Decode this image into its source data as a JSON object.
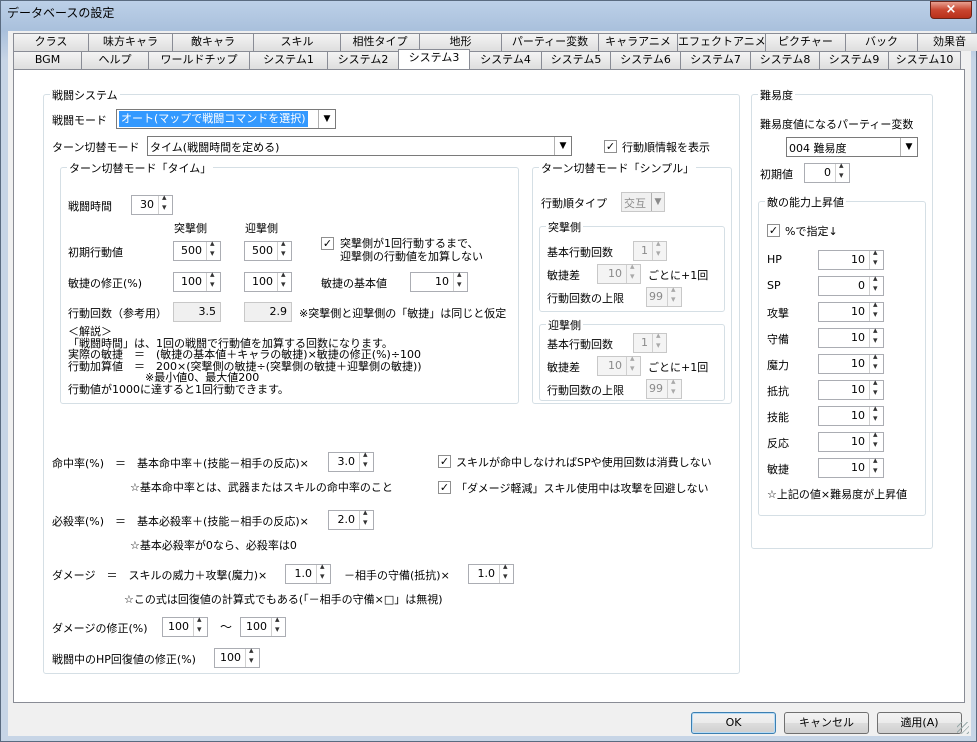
{
  "window": {
    "title": "データベースの設定",
    "close_icon": "×"
  },
  "tabs_row1": [
    "クラス",
    "味方キャラ",
    "敵キャラ",
    "スキル",
    "相性タイプ",
    "地形",
    "パーティー変数",
    "キャラアニメ",
    "エフェクトアニメ",
    "ピクチャー",
    "バック",
    "効果音"
  ],
  "tabs_row2": [
    "BGM",
    "ヘルプ",
    "ワールドチップ",
    "システム1",
    "システム2",
    "システム3",
    "システム4",
    "システム5",
    "システム6",
    "システム7",
    "システム8",
    "システム9",
    "システム10"
  ],
  "battle": {
    "group_label": "戦闘システム",
    "mode_label": "戦闘モード",
    "mode_value": "オート(マップで戦闘コマンドを選択)",
    "turn_mode_label": "ターン切替モード",
    "turn_mode_value": "タイム(戦闘時間を定める)",
    "show_order_label": "行動順情報を表示",
    "show_order_checked": "✓"
  },
  "time": {
    "group_label": "ターン切替モード「タイム」",
    "battle_time_label": "戦闘時間",
    "battle_time_value": "30",
    "attack_header": "突撃側",
    "defend_header": "迎撃側",
    "init_label": "初期行動値",
    "init_attack": "500",
    "init_defend": "500",
    "no_add_label_1": "突撃側が1回行動するまで、",
    "no_add_label_2": "迎撃側の行動値を加算しない",
    "no_add_checked": "✓",
    "agi_mod_label": "敏捷の修正(%)",
    "agi_mod_attack": "100",
    "agi_mod_defend": "100",
    "agi_base_label": "敏捷の基本値",
    "agi_base_value": "10",
    "count_label": "行動回数（参考用）",
    "count_attack": "3.5",
    "count_defend": "2.9",
    "count_note": "※突撃側と迎撃側の「敏捷」は同じと仮定",
    "explain": [
      "＜解説＞",
      "「戦闘時間」は、1回の戦闘で行動値を加算する回数になります。",
      "実際の敏捷　＝　(敏捷の基本値＋キャラの敏捷)×敏捷の修正(%)÷100",
      "行動加算値　＝　200×(突撃側の敏捷÷(突撃側の敏捷＋迎撃側の敏捷))",
      "　　　　　　　※最小値0、最大値200",
      "行動値が1000に達すると1回行動できます。"
    ]
  },
  "simple": {
    "group_label": "ターン切替モード「シンプル」",
    "order_type_label": "行動順タイプ",
    "order_type_value": "交互",
    "attack_group": "突撃側",
    "defend_group": "迎撃側",
    "base_count_label": "基本行動回数",
    "agi_diff_label": "敏捷差",
    "per_label": "ごとに+1回",
    "limit_label": "行動回数の上限",
    "attack_base": "1",
    "attack_diff": "10",
    "attack_limit": "99",
    "defend_base": "1",
    "defend_diff": "10",
    "defend_limit": "99"
  },
  "formula": {
    "hit_label": "命中率(%)　＝　基本命中率＋(技能－相手の反応)×",
    "hit_value": "3.0",
    "hit_note": "☆基本命中率とは、武器またはスキルの命中率のこと",
    "miss_sp_label": "スキルが命中しなければSPや使用回数は消費しない",
    "miss_sp_checked": "✓",
    "reduce_label": "「ダメージ軽減」スキル使用中は攻撃を回避しない",
    "reduce_checked": "✓",
    "crit_label": "必殺率(%)　＝　基本必殺率＋(技能－相手の反応)×",
    "crit_value": "2.0",
    "crit_note": "☆基本必殺率が0なら、必殺率は0",
    "dmg_label": "ダメージ　＝　スキルの威力＋攻撃(魔力)×",
    "dmg_value": "1.0",
    "dmg_minus_label": "－相手の守備(抵抗)×",
    "dmg_minus_value": "1.0",
    "dmg_note": "☆この式は回復値の計算式でもある(「－相手の守備×□」は無視)",
    "dmg_mod_label": "ダメージの修正(%)",
    "dmg_mod_min": "100",
    "tilde": "～",
    "dmg_mod_max": "100",
    "hp_mod_label": "戦闘中のHP回復値の修正(%)",
    "hp_mod_value": "100"
  },
  "difficulty": {
    "group_label": "難易度",
    "var_label": "難易度値になるパーティー変数",
    "var_value": "004 難易度",
    "init_label": "初期値",
    "init_value": "0",
    "ability_group": "敵の能力上昇値",
    "percent_label": "%で指定↓",
    "percent_checked": "✓",
    "stats": [
      {
        "label": "HP",
        "value": "10"
      },
      {
        "label": "SP",
        "value": "0"
      },
      {
        "label": "攻撃",
        "value": "10"
      },
      {
        "label": "守備",
        "value": "10"
      },
      {
        "label": "魔力",
        "value": "10"
      },
      {
        "label": "抵抗",
        "value": "10"
      },
      {
        "label": "技能",
        "value": "10"
      },
      {
        "label": "反応",
        "value": "10"
      },
      {
        "label": "敏捷",
        "value": "10"
      }
    ],
    "note": "☆上記の値×難易度が上昇値"
  },
  "buttons": {
    "ok": "OK",
    "cancel": "キャンセル",
    "apply": "適用(A)"
  }
}
